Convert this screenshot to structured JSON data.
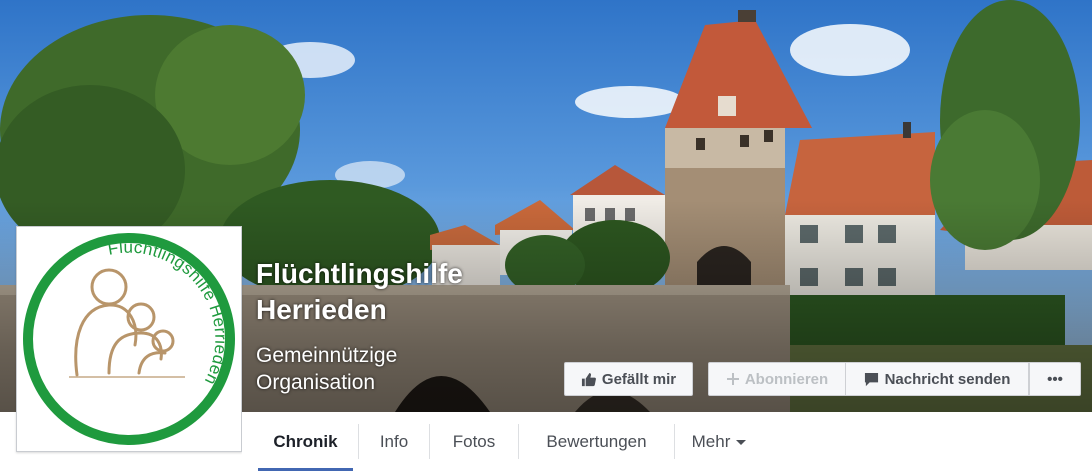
{
  "page": {
    "name_line1": "Flüchtlingshilfe",
    "name_line2": "Herrieden",
    "category_line1": "Gemeinnützige",
    "category_line2": "Organisation"
  },
  "logo": {
    "text": "Flüchtlingshilfe Herrieden",
    "ring_color": "#1f9a3e",
    "figure_color": "#b8956a"
  },
  "actions": {
    "like_label": "Gefällt mir",
    "follow_label": "Abonnieren",
    "message_label": "Nachricht senden",
    "more_label": "•••"
  },
  "tabs": [
    {
      "label": "Chronik",
      "active": true
    },
    {
      "label": "Info",
      "active": false
    },
    {
      "label": "Fotos",
      "active": false
    },
    {
      "label": "Bewertungen",
      "active": false
    },
    {
      "label": "Mehr",
      "active": false
    }
  ],
  "colors": {
    "accent": "#4267b2",
    "button_bg": "#f6f7f9",
    "text_dark": "#4b4f56"
  },
  "icons": {
    "like": "thumbs-up-icon",
    "follow": "plus-icon",
    "message": "speech-bubble-icon",
    "more": "ellipsis-icon",
    "dropdown": "caret-down-icon"
  }
}
